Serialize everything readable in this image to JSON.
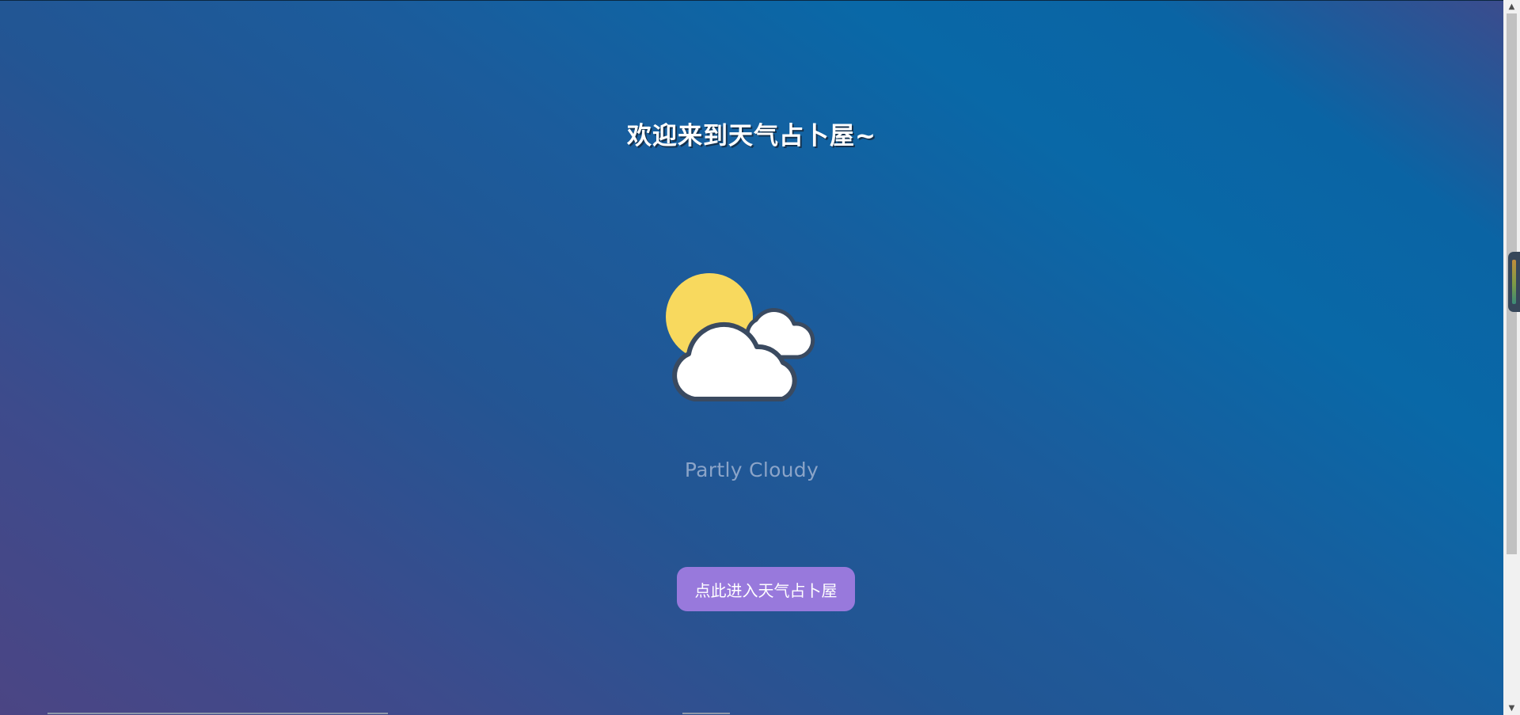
{
  "page": {
    "title": "欢迎来到天气占卜屋~"
  },
  "weather": {
    "icon": "partly-cloudy-icon",
    "condition": "Partly Cloudy"
  },
  "actions": {
    "enter_label": "点此进入天气占卜屋"
  },
  "colors": {
    "background_blue": "#0968a7",
    "background_purple": "#4b4584",
    "sun": "#f8d95e",
    "cloud_fill": "#ffffff",
    "cloud_outline": "#3a4a60",
    "button": "#9879dc",
    "condition_text": "#8ba4c8"
  }
}
